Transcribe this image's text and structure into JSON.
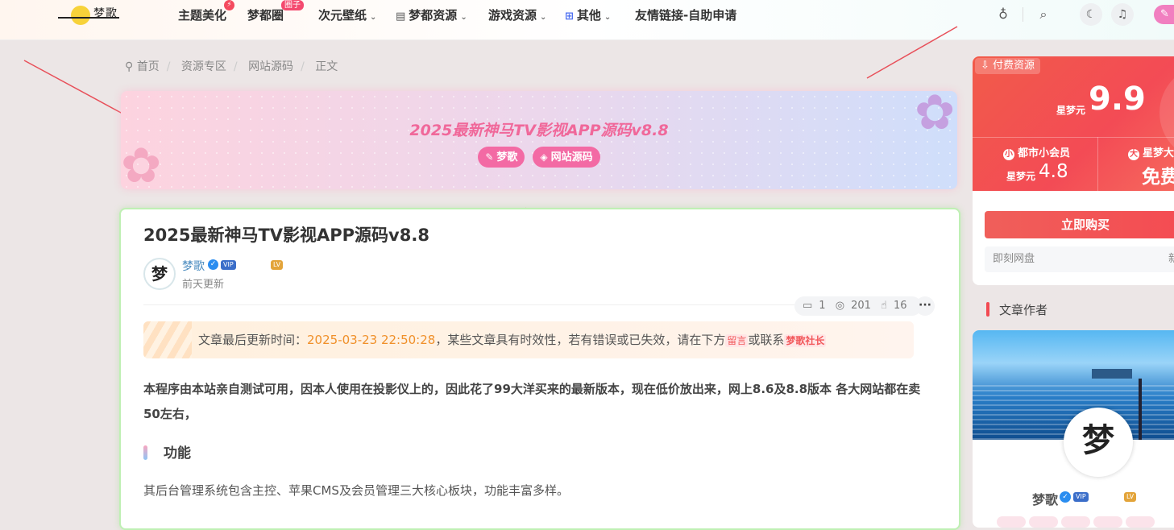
{
  "nav": {
    "logo": {
      "text": "梦歌"
    },
    "items": [
      {
        "label": "主题美化",
        "badge": "⚡"
      },
      {
        "label": "梦都圈",
        "badge": "圈子"
      },
      {
        "label": "次元壁纸"
      },
      {
        "label": "梦都资源",
        "icon": "clipboard-icon"
      },
      {
        "label": "游戏资源"
      },
      {
        "label": "其他",
        "icon": "grid-icon"
      },
      {
        "label": "友情链接-自助申请"
      }
    ],
    "right_icons": [
      "bulb-icon",
      "search-icon",
      "moon-icon",
      "bell-icon",
      "pen-icon"
    ]
  },
  "breadcrumb": [
    "首页",
    "资源专区",
    "网站源码",
    "正文"
  ],
  "hero": {
    "title": "2025最新神马TV影视APP源码v8.8",
    "tags": [
      "梦歌",
      "网站源码"
    ]
  },
  "article": {
    "title": "2025最新神马TV影视APP源码v8.8",
    "author": "梦歌",
    "time": "前天更新",
    "stats": {
      "comments": "1",
      "views": "201",
      "likes": "16"
    },
    "notice": {
      "prefix": "文章最后更新时间：",
      "time": "2025-03-23 22:50:28",
      "middle": "，某些文章具有时效性，若有错误或已失效，请在下方",
      "tag1": "留言",
      "or": "或联系",
      "tag2": "梦歌社长"
    },
    "para1": "本程序由本站亲自测试可用，因本人使用在投影仪上的，因此花了99大洋买来的最新版本，现在低价放出来，网上8.6及8.8版本 各大网站都在卖50左右，",
    "section_heading": "功能",
    "para2": "其后台管理系统包含主控、苹果CMS及会员管理三大核心板块，功能丰富多样。"
  },
  "sidebar": {
    "badge": "付费资源",
    "unit": "星梦元",
    "price": "9.9",
    "vip1_label": "都市小会员",
    "vip1_unit": "星梦元",
    "vip1_price": "4.8",
    "vip2_label": "星梦大会员",
    "vip2_price": "免费",
    "buy_button": "立即购买",
    "disk_label": "即刻网盘",
    "disk_right": "新",
    "author_heading": "文章作者",
    "author_name": "梦歌"
  },
  "colors": {
    "accent": "#f24a52",
    "hero_pink": "#f0689a",
    "tag_pink": "#f36aa4",
    "orange_time": "#f0902a"
  }
}
